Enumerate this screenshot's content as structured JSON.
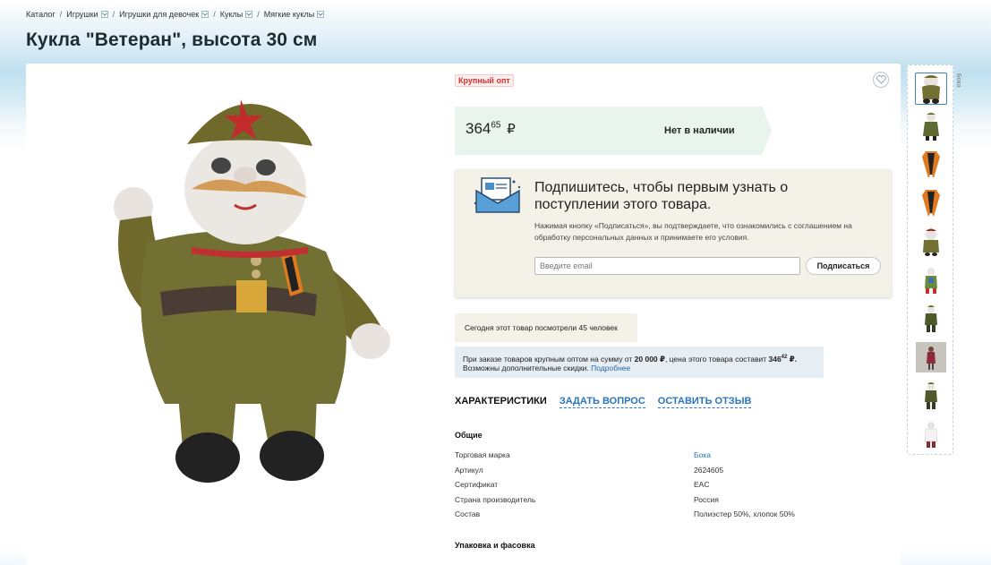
{
  "breadcrumb": {
    "items": [
      "Каталог",
      "Игрушки",
      "Игрушки для девочек",
      "Куклы",
      "Мягкие куклы"
    ],
    "separator": "/"
  },
  "product": {
    "title": "Кукла \"Ветеран\", высота 30 см",
    "badge": "Крупный опт",
    "price_int": "364",
    "price_frac": "65",
    "currency": "₽",
    "availability": "Нет в наличии"
  },
  "subscribe": {
    "title": "Подпишитесь, чтобы первым узнать о поступлении этого товара.",
    "terms": "Нажимая кнопку «Подписаться», вы подтверждаете, что ознакомились с соглашением на обработку персональных данных и принимаете его условия.",
    "email_placeholder": "Введите email",
    "button_label": "Подписаться"
  },
  "views_text": "Сегодня этот товар посмотрели 45 человек",
  "wholesale": {
    "line1_pre": "При заказе товаров крупным оптом на сумму от ",
    "threshold": "20 000 ₽",
    "line1_mid": ", цена этого товара составит ",
    "price_int": "346",
    "price_frac": "42",
    "line1_end": " ₽.",
    "line2": "Возможны дополнительные скидки. ",
    "more_link": "Подробнее"
  },
  "tabs": [
    "ХАРАКТЕРИСТИКИ",
    "ЗАДАТЬ ВОПРОС",
    "ОСТАВИТЬ ОТЗЫВ"
  ],
  "specs": {
    "section_general": "Общие",
    "rows": [
      {
        "name": "Торговая марка",
        "value": "Бока"
      },
      {
        "name": "Артикул",
        "value": "2624605"
      },
      {
        "name": "Сертификат",
        "value": "EAC"
      },
      {
        "name": "Страна производитель",
        "value": "Россия"
      },
      {
        "name": "Состав",
        "value": "Полиэстер 50%, хлопок 50%"
      }
    ],
    "section_packing": "Упаковка и фасовка"
  },
  "thumbnails_label": "Бока",
  "thumbnails_count": 10,
  "colors": {
    "accent_link": "#2a75bb",
    "badge_red": "#d93030",
    "price_bg": "#e9f5ec",
    "subscribe_bg": "#f4f1e8",
    "title": "#1d2b36"
  },
  "icons": [
    "heart-icon",
    "envelope-icon",
    "chevron-down-icon"
  ]
}
